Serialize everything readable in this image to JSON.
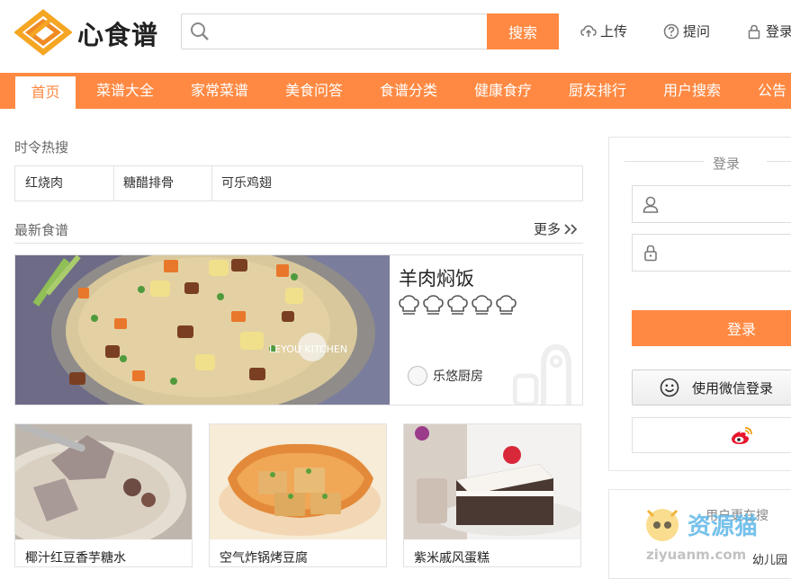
{
  "header": {
    "logo_text": "心食谱",
    "search_placeholder": "",
    "search_button": "搜索",
    "links": [
      {
        "icon": "cloud-upload-icon",
        "label": "上传"
      },
      {
        "icon": "question-circle-icon",
        "label": "提问"
      },
      {
        "icon": "lock-icon",
        "label": "登录"
      }
    ]
  },
  "nav": {
    "items": [
      "首页",
      "菜谱大全",
      "家常菜谱",
      "美食问答",
      "食谱分类",
      "健康食疗",
      "厨友排行",
      "用户搜索",
      "公告"
    ],
    "active_index": 0
  },
  "seasonal": {
    "title": "时令热搜",
    "tags": [
      "红烧肉",
      "糖醋排骨",
      "可乐鸡翅"
    ]
  },
  "latest": {
    "title": "最新食谱",
    "more": "更多",
    "featured": {
      "title": "羊肉焖饭",
      "rating": 0,
      "rating_max": 5,
      "author": "乐悠厨房",
      "image_watermark": "LEYOU KITCHEN"
    },
    "cards": [
      {
        "title": "椰汁红豆香芋糖水"
      },
      {
        "title": "空气炸锅烤豆腐"
      },
      {
        "title": "紫米戚风蛋糕"
      }
    ]
  },
  "sidebar": {
    "login": {
      "title": "登录",
      "username_placeholder": "",
      "password_placeholder": "",
      "login_button": "登录",
      "wechat_button": "使用微信登录"
    },
    "active_users": {
      "title": "用户更在搜",
      "items": [
        "幼儿园"
      ]
    }
  },
  "watermark": {
    "brand": "资源猫",
    "url": "ziyuanm.com"
  },
  "colors": {
    "accent": "#ff8942",
    "border": "#e2e2e2",
    "weibo": "#e6162d"
  }
}
